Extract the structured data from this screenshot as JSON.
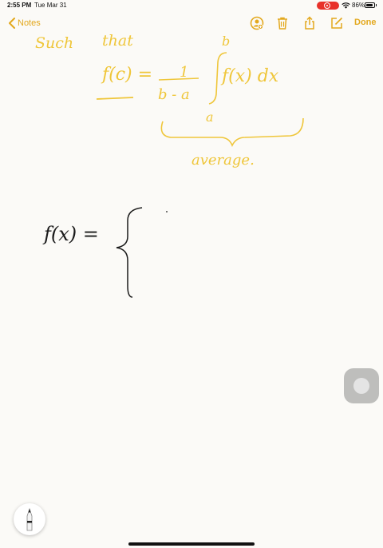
{
  "status_bar": {
    "time": "2:55 PM",
    "date": "Tue Mar 31",
    "battery": "86%",
    "battery_level": 0.86
  },
  "toolbar": {
    "back_label": "Notes",
    "done_label": "Done",
    "icons": [
      "collaborate-icon",
      "trash-icon",
      "share-icon",
      "compose-icon"
    ]
  },
  "note": {
    "handwriting_yellow": [
      "Such",
      "that",
      "b",
      "f(c) =",
      "1",
      "b - a",
      "f(x) dx",
      "a",
      "average."
    ],
    "handwriting_black": [
      "f(x) ="
    ]
  },
  "colors": {
    "accent": "#e3a81d",
    "ink_yellow": "#efc63a",
    "ink_black": "#1a1a1a",
    "paper": "#fbfaf7"
  }
}
